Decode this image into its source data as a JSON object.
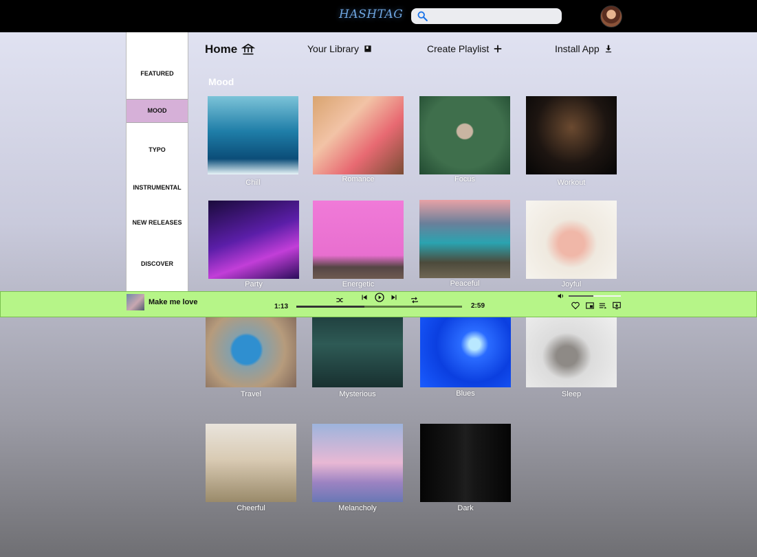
{
  "app": {
    "logo": "HASHTAG"
  },
  "search": {
    "placeholder": "",
    "value": ""
  },
  "colors": {
    "accent": "#d6b0d8",
    "player_bg": "#b6f588",
    "logo": "#6fa6e0"
  },
  "sidebar": {
    "items": [
      {
        "label": "FEATURED",
        "active": false
      },
      {
        "label": "MOOD",
        "active": true
      },
      {
        "label": "TYPO",
        "active": false
      },
      {
        "label": "INSTRUMENTAL",
        "active": false
      },
      {
        "label": "NEW RELEASES",
        "active": false
      },
      {
        "label": "DISCOVER",
        "active": false
      }
    ]
  },
  "nav": {
    "home": {
      "label": "Home",
      "icon": "bank-icon"
    },
    "library": {
      "label": "Your Library",
      "icon": "library-icon"
    },
    "create": {
      "label": "Create Playlist",
      "icon": "plus-icon"
    },
    "install": {
      "label": "Install App",
      "icon": "download-icon"
    }
  },
  "section": {
    "title": "Mood"
  },
  "moods": [
    {
      "label": "Chill"
    },
    {
      "label": "Romance"
    },
    {
      "label": "Focus"
    },
    {
      "label": "Workout"
    },
    {
      "label": "Party"
    },
    {
      "label": "Energetic"
    },
    {
      "label": "Peaceful"
    },
    {
      "label": "Joyful"
    },
    {
      "label": "Travel"
    },
    {
      "label": "Mysterious"
    },
    {
      "label": "Blues"
    },
    {
      "label": "Sleep"
    },
    {
      "label": "Cheerful"
    },
    {
      "label": "Melancholy"
    },
    {
      "label": "Dark"
    }
  ],
  "player": {
    "track": "Make me love",
    "current_time": "1:13",
    "total_time": "2:59",
    "progress": 0.41,
    "volume": 0.47
  }
}
